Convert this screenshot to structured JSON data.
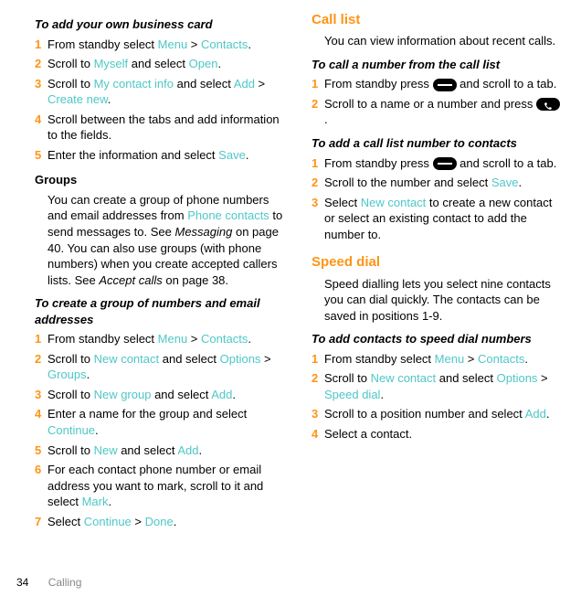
{
  "footer": {
    "page_num": "34",
    "section": "Calling"
  },
  "left": {
    "h1": "To add your own business card",
    "list1": {
      "s1a": "From standby select ",
      "s1b": "Menu",
      "s1c": " > ",
      "s1d": "Contacts",
      "s1e": ".",
      "s2a": "Scroll to ",
      "s2b": "Myself",
      "s2c": " and select ",
      "s2d": "Open",
      "s2e": ".",
      "s3a": "Scroll to ",
      "s3b": "My contact info",
      "s3c": " and select ",
      "s3d": "Add",
      "s3e": " > ",
      "s3f": "Create new",
      "s3g": ".",
      "s4": "Scroll between the tabs and add information to the fields.",
      "s5a": "Enter the information and select ",
      "s5b": "Save",
      "s5c": "."
    },
    "h2": "Groups",
    "p_groups_a": "You can create a group of phone numbers and email addresses from ",
    "p_groups_b": "Phone contacts",
    "p_groups_c": " to send messages to. See ",
    "p_groups_d": "Messaging",
    "p_groups_e": " on page 40. You can also use groups (with phone numbers) when you create accepted callers lists. See ",
    "p_groups_f": "Accept calls",
    "p_groups_g": " on page 38.",
    "h3": "To create a group of numbers and email addresses",
    "list2": {
      "s1a": "From standby select ",
      "s1b": "Menu",
      "s1c": " > ",
      "s1d": "Contacts",
      "s1e": ".",
      "s2a": "Scroll to ",
      "s2b": "New contact",
      "s2c": " and select ",
      "s2d": "Options",
      "s2e": " > ",
      "s2f": "Groups",
      "s2g": ".",
      "s3a": "Scroll to ",
      "s3b": "New group",
      "s3c": " and select ",
      "s3d": "Add",
      "s3e": ".",
      "s4a": "Enter a name for the group and select ",
      "s4b": "Continue",
      "s4c": ".",
      "s5a": "Scroll to ",
      "s5b": "New",
      "s5c": " and select ",
      "s5d": "Add",
      "s5e": ".",
      "s6a": "For each contact phone number or email address you want to mark, scroll to it and select ",
      "s6b": "Mark",
      "s6c": ".",
      "s7a": "Select ",
      "s7b": "Continue",
      "s7c": " > ",
      "s7d": "Done",
      "s7e": "."
    }
  },
  "right": {
    "h1": "Call list",
    "p1": "You can view information about recent calls.",
    "h2": "To call a number from the call list",
    "list1": {
      "s1a": "From standby press ",
      "s1b": " and scroll to a tab.",
      "s2a": "Scroll to a name or a number and press ",
      "s2b": "."
    },
    "h3": "To add a call list number to contacts",
    "list2": {
      "s1a": "From standby press ",
      "s1b": " and scroll to a tab.",
      "s2a": "Scroll to the number and select ",
      "s2b": "Save",
      "s2c": ".",
      "s3a": "Select ",
      "s3b": "New contact",
      "s3c": " to create a new contact or select an existing contact to add the number to."
    },
    "h4": "Speed dial",
    "p2": "Speed dialling lets you select nine contacts you can dial quickly. The contacts can be saved in positions 1-9.",
    "h5": "To add contacts to speed dial numbers",
    "list3": {
      "s1a": "From standby select ",
      "s1b": "Menu",
      "s1c": " > ",
      "s1d": "Contacts",
      "s1e": ".",
      "s2a": "Scroll to ",
      "s2b": "New contact",
      "s2c": " and select ",
      "s2d": "Options",
      "s2e": " > ",
      "s2f": "Speed dial",
      "s2g": ".",
      "s3a": "Scroll to a position number and select ",
      "s3b": "Add",
      "s3c": ".",
      "s4": "Select a contact."
    }
  },
  "nums": {
    "n1": "1",
    "n2": "2",
    "n3": "3",
    "n4": "4",
    "n5": "5",
    "n6": "6",
    "n7": "7"
  }
}
